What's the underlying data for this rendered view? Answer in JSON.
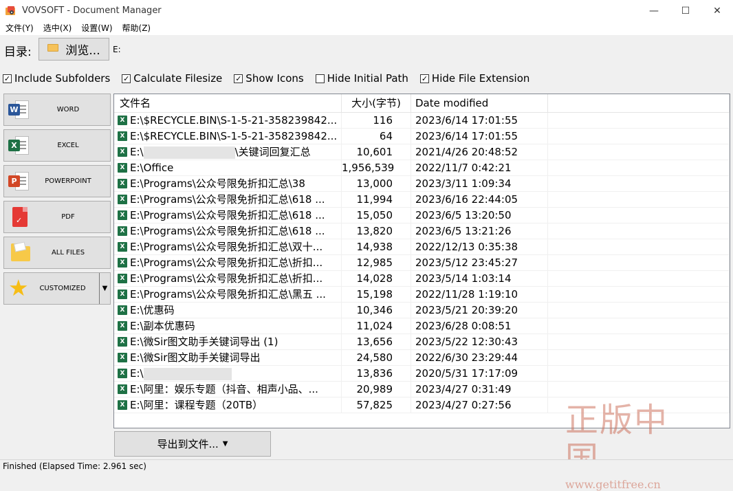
{
  "window": {
    "title": "VOVSOFT - Document Manager",
    "controls": {
      "minimize": "—",
      "maximize": "☐",
      "close": "✕"
    }
  },
  "menu": [
    "文件(Y)",
    "选中(X)",
    "设置(W)",
    "帮助(Z)"
  ],
  "directory": {
    "label": "目录:",
    "browse_label": "浏览...",
    "path": "E:"
  },
  "options": [
    {
      "label": "Include Subfolders",
      "checked": true
    },
    {
      "label": "Calculate Filesize",
      "checked": true
    },
    {
      "label": "Show Icons",
      "checked": true
    },
    {
      "label": "Hide Initial Path",
      "checked": false
    },
    {
      "label": "Hide File Extension",
      "checked": true
    }
  ],
  "sidebar": [
    {
      "label": "WORD",
      "icon": "word-icon"
    },
    {
      "label": "EXCEL",
      "icon": "excel-icon"
    },
    {
      "label": "POWERPOINT",
      "icon": "powerpoint-icon"
    },
    {
      "label": "PDF",
      "icon": "pdf-icon"
    },
    {
      "label": "ALL FILES",
      "icon": "folder-icon"
    },
    {
      "label": "CUSTOMIZED",
      "icon": "star-icon"
    }
  ],
  "table": {
    "columns": [
      "文件名",
      "大小(字节)",
      "Date modified"
    ],
    "rows": [
      {
        "name": "E:\\$RECYCLE.BIN\\S-1-5-21-358239842...",
        "size": "116",
        "date": "2023/6/14 17:01:55"
      },
      {
        "name": "E:\\$RECYCLE.BIN\\S-1-5-21-358239842...",
        "size": "64",
        "date": "2023/6/14 17:01:55"
      },
      {
        "name_prefix": "E:\\",
        "name_suffix": "\\关键词回复汇总",
        "redacted": true,
        "size": "10,601",
        "date": "2021/4/26 20:48:52"
      },
      {
        "name": "E:\\Office",
        "size": "1,956,539",
        "date": "2022/11/7 0:42:21"
      },
      {
        "name": "E:\\Programs\\公众号限免折扣汇总\\38",
        "size": "13,000",
        "date": "2023/3/11 1:09:34"
      },
      {
        "name": "E:\\Programs\\公众号限免折扣汇总\\618 ...",
        "size": "11,994",
        "date": "2023/6/16 22:44:05"
      },
      {
        "name": "E:\\Programs\\公众号限免折扣汇总\\618 ...",
        "size": "15,050",
        "date": "2023/6/5 13:20:50"
      },
      {
        "name": "E:\\Programs\\公众号限免折扣汇总\\618 ...",
        "size": "13,820",
        "date": "2023/6/5 13:21:26"
      },
      {
        "name": "E:\\Programs\\公众号限免折扣汇总\\双十...",
        "size": "14,938",
        "date": "2022/12/13 0:35:38"
      },
      {
        "name": "E:\\Programs\\公众号限免折扣汇总\\折扣...",
        "size": "12,985",
        "date": "2023/5/12 23:45:27"
      },
      {
        "name": "E:\\Programs\\公众号限免折扣汇总\\折扣...",
        "size": "14,028",
        "date": "2023/5/14 1:03:14"
      },
      {
        "name": "E:\\Programs\\公众号限免折扣汇总\\黑五 ...",
        "size": "15,198",
        "date": "2022/11/28 1:19:10"
      },
      {
        "name": "E:\\优惠码",
        "size": "10,346",
        "date": "2023/5/21 20:39:20"
      },
      {
        "name": "E:\\副本优惠码",
        "size": "11,024",
        "date": "2023/6/28 0:08:51"
      },
      {
        "name": "E:\\微Sir图文助手关键词导出 (1)",
        "size": "13,656",
        "date": "2023/5/22 12:30:43"
      },
      {
        "name": "E:\\微Sir图文助手关键词导出",
        "size": "24,580",
        "date": "2022/6/30 23:29:44"
      },
      {
        "name_prefix": "E:\\",
        "name_suffix": "",
        "redacted": true,
        "size": "13,836",
        "date": "2020/5/31 17:17:09"
      },
      {
        "name": "E:\\阿里：娱乐专题（抖音、相声小品、...",
        "size": "20,989",
        "date": "2023/4/27 0:31:49"
      },
      {
        "name": "E:\\阿里：课程专题（20TB）",
        "size": "57,825",
        "date": "2023/4/27 0:27:56"
      }
    ]
  },
  "export_label": "导出到文件...",
  "status": "Finished (Elapsed Time: 2.961 sec)",
  "watermark": {
    "main": "正版中国",
    "sub": "www.getitfree.cn"
  },
  "colors": {
    "excel_green": "#1e7145",
    "word_blue": "#2b579a",
    "ppt_orange": "#d24726",
    "pdf_red": "#e53935"
  }
}
